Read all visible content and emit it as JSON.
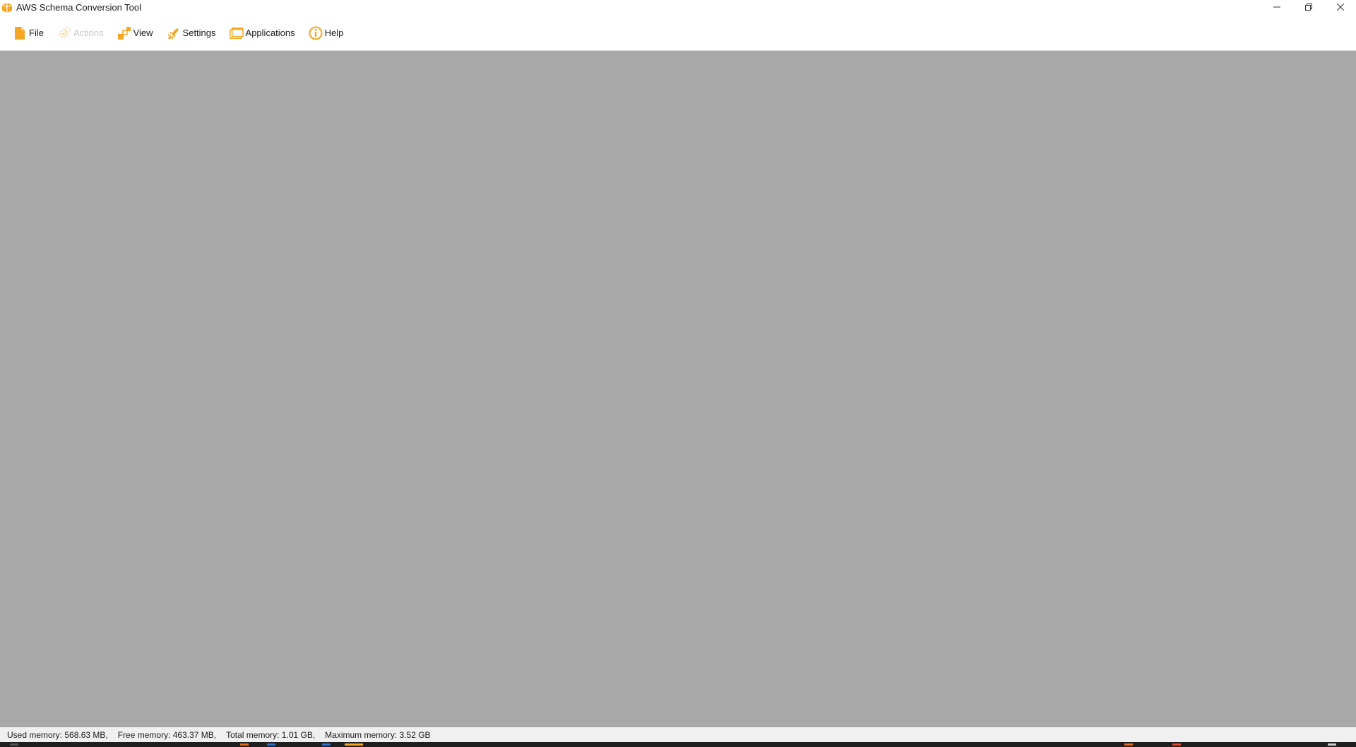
{
  "window": {
    "title": "AWS Schema Conversion Tool",
    "controls": {
      "minimize": "minimize-icon",
      "restore": "restore-icon",
      "close": "close-icon"
    }
  },
  "menu": {
    "items": [
      {
        "label": "File",
        "icon": "file-icon",
        "enabled": true
      },
      {
        "label": "Actions",
        "icon": "actions-gear-icon",
        "enabled": false
      },
      {
        "label": "View",
        "icon": "view-icon",
        "enabled": true
      },
      {
        "label": "Settings",
        "icon": "settings-icon",
        "enabled": true
      },
      {
        "label": "Applications",
        "icon": "applications-icon",
        "enabled": true
      },
      {
        "label": "Help",
        "icon": "help-icon",
        "enabled": true
      }
    ]
  },
  "status": {
    "used_memory": "Used memory: 568.63 MB,",
    "free_memory": "Free memory: 463.37 MB,",
    "total_memory": "Total memory: 1.01 GB,",
    "max_memory": "Maximum memory: 3.52 GB"
  },
  "colors": {
    "accent": "#f5a623",
    "workspace": "#a8a8a8",
    "disabled": "#c8c8c8"
  }
}
